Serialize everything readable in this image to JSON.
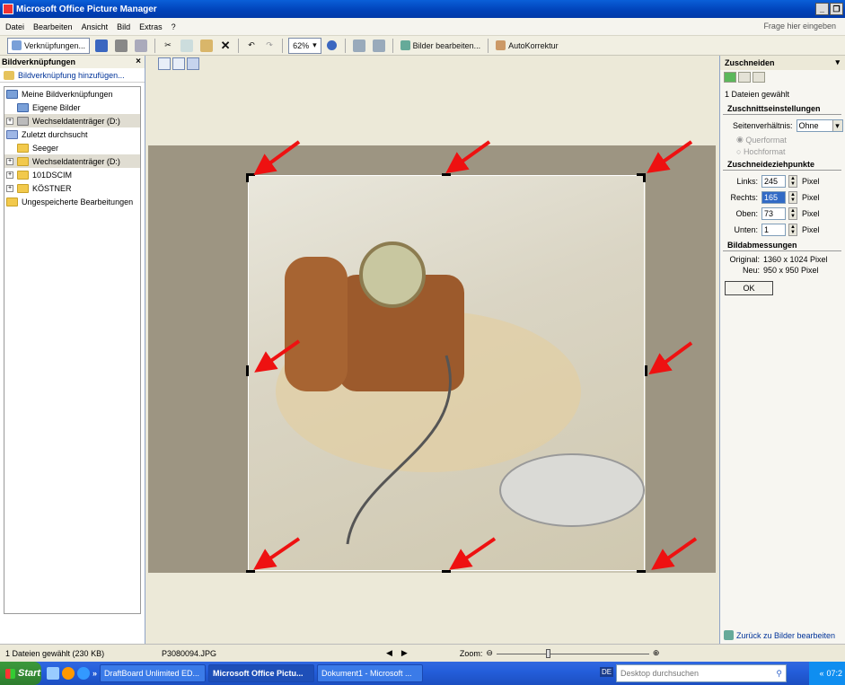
{
  "window": {
    "title": "Microsoft Office Picture Manager"
  },
  "menu": {
    "items": [
      "Datei",
      "Bearbeiten",
      "Ansicht",
      "Bild",
      "Extras",
      "?"
    ],
    "help_placeholder": "Frage hier eingeben"
  },
  "toolbar": {
    "shortcuts": "Verknüpfungen...",
    "zoom": "62%",
    "edit_pictures": "Bilder bearbeiten...",
    "autocorrect": "AutoKorrektur"
  },
  "left_pane": {
    "title": "Bildverknüpfungen",
    "add_link": "Bildverknüpfung hinzufügen...",
    "tree": [
      {
        "label": "Meine Bildverknüpfungen",
        "indent": 0,
        "pm": "",
        "icon": "shortcuts"
      },
      {
        "label": "Eigene Bilder",
        "indent": 1,
        "pm": "",
        "icon": "pictures"
      },
      {
        "label": "Wechseldatenträger (D:)",
        "indent": 0,
        "pm": "+",
        "icon": "drive",
        "selected": true
      },
      {
        "label": "Zuletzt durchsucht",
        "indent": 0,
        "pm": "",
        "icon": "recent"
      },
      {
        "label": "Seeger",
        "indent": 1,
        "pm": "",
        "icon": "folder"
      },
      {
        "label": "Wechseldatenträger (D:)",
        "indent": 0,
        "pm": "+",
        "icon": "folder",
        "selected": true
      },
      {
        "label": "101DSCIM",
        "indent": 0,
        "pm": "+",
        "icon": "folder"
      },
      {
        "label": "KÖSTNER",
        "indent": 0,
        "pm": "+",
        "icon": "folder"
      },
      {
        "label": "Ungespeicherte Bearbeitungen",
        "indent": 0,
        "pm": "",
        "icon": "unsaved"
      }
    ]
  },
  "right_pane": {
    "title": "Zuschneiden",
    "selected_count": "1 Dateien gewählt",
    "section_settings": "Zuschnittseinstellungen",
    "ratio_label": "Seitenverhältnis:",
    "ratio_value": "Ohne",
    "landscape": "Querformat",
    "portrait": "Hochformat",
    "section_handles": "Zuschneideziehpunkte",
    "fields": [
      {
        "label": "Links:",
        "value": "245",
        "unit": "Pixel"
      },
      {
        "label": "Rechts:",
        "value": "165",
        "unit": "Pixel"
      },
      {
        "label": "Oben:",
        "value": "73",
        "unit": "Pixel"
      },
      {
        "label": "Unten:",
        "value": "1",
        "unit": "Pixel"
      }
    ],
    "section_dims": "Bildabmessungen",
    "original_label": "Original:",
    "original_value": "1360 x 1024 Pixel",
    "new_label": "Neu:",
    "new_value": "950 x 950 Pixel",
    "ok": "OK",
    "back_link": "Zurück zu Bilder bearbeiten"
  },
  "status": {
    "count": "1 Dateien gewählt (230 KB)",
    "filename": "P3080094.JPG",
    "zoom_label": "Zoom:"
  },
  "taskbar": {
    "start": "Start",
    "tasks": [
      "DraftBoard Unlimited ED...",
      "Microsoft Office Pictu...",
      "Dokument1 - Microsoft ..."
    ],
    "search_placeholder": "Desktop durchsuchen",
    "lang": "DE",
    "clock": "07:2"
  },
  "colors": {
    "accent": "#0a5fd8",
    "arrow": "#ee1111",
    "link": "#003399"
  }
}
